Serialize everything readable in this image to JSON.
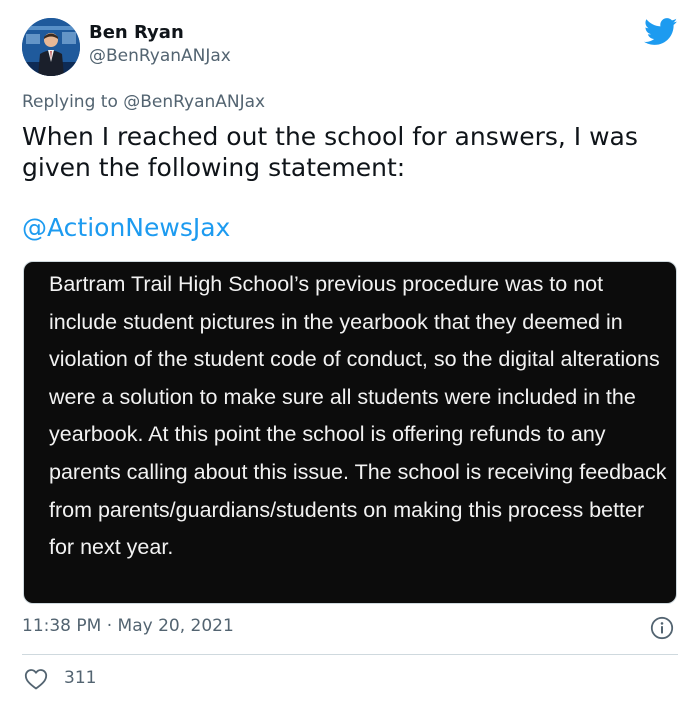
{
  "author": {
    "name": "Ben Ryan",
    "handle": "@BenRyanANJax",
    "avatar_icon": "news-anchor-avatar"
  },
  "brand": {
    "icon": "twitter-bird-icon",
    "color": "#1d9bf0"
  },
  "reply": {
    "prefix": "Replying to",
    "mention": "@BenRyanANJax"
  },
  "tweet": {
    "text": "When I reached out the school for answers, I was given the following statement:",
    "link": "@ActionNewsJax"
  },
  "statement": {
    "text": "Bartram Trail High School’s previous procedure was to not include student pictures in the yearbook that they deemed in violation of the student code of conduct, so the digital alterations were a solution to make sure all students were included in the yearbook. At this point the school is offering refunds to any parents calling about this issue. The school is receiving feedback from parents/guardians/students on making this process better for next year."
  },
  "meta": {
    "timestamp": "11:38 PM · May 20, 2021",
    "info_icon": "info-icon"
  },
  "engagement": {
    "like_icon": "heart-icon",
    "likes": "311"
  }
}
